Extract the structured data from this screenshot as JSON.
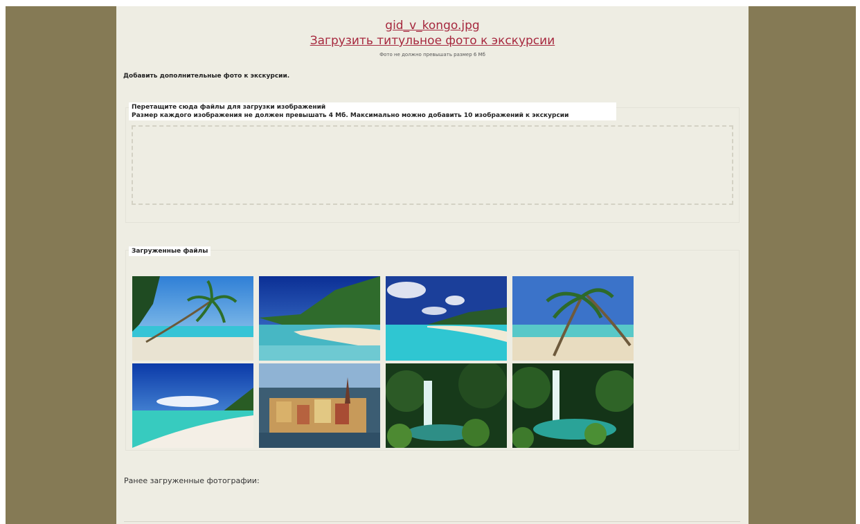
{
  "title_photo": {
    "filename": "gid_v_kongo.jpg",
    "upload_link": "Загрузить титульное фото к экскурсии",
    "size_note": "Фото не должно превышать размер 6 Мб"
  },
  "additional": {
    "title": "Добавить дополнительные фото к экскурсии."
  },
  "dropzone": {
    "line1": "Перетащите сюда файлы для загрузки изображений",
    "line2": "Размер каждого изображения не должен превышать 4 Мб. Максимально можно добавить 10 изображений к экскурсии"
  },
  "uploaded": {
    "title": "Загруженные файлы",
    "photos": [
      {
        "subject": "beach-leaning-palm"
      },
      {
        "subject": "tropical-island-shore"
      },
      {
        "subject": "turquoise-lagoon"
      },
      {
        "subject": "palm-trees-beach"
      },
      {
        "subject": "white-sand-beach"
      },
      {
        "subject": "old-town-island-city"
      },
      {
        "subject": "jungle-waterfall"
      },
      {
        "subject": "waterfall-pool"
      }
    ]
  },
  "previous": {
    "title": "Ранее загруженные фотографии:"
  }
}
